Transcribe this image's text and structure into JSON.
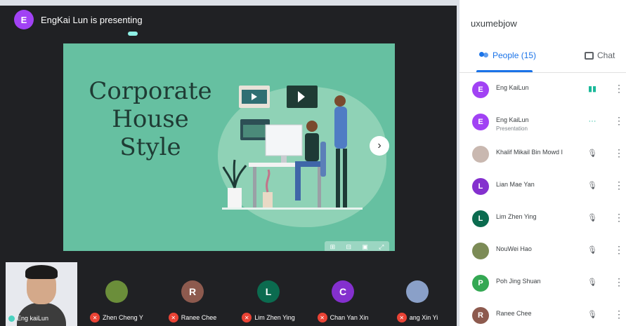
{
  "presenter": {
    "initial": "E",
    "text": "EngKai Lun is presenting",
    "color": "#a142f4"
  },
  "slide": {
    "title_lines": [
      "Corporate",
      "House",
      "Style"
    ],
    "next_icon": "chevron-right-icon",
    "controls": [
      "⊞",
      "⊟",
      "▣",
      "⤢"
    ]
  },
  "self_view": {
    "name": "Eng kaiLun"
  },
  "filmstrip": [
    {
      "name": "Zhen Cheng Y",
      "initial": "",
      "color": "#6b8e3a"
    },
    {
      "name": "Ranee Chee",
      "initial": "R",
      "color": "#8d5a4e"
    },
    {
      "name": "Lim Zhen Ying",
      "initial": "L",
      "color": "#0b6b4f"
    },
    {
      "name": "Chan Yan Xin",
      "initial": "C",
      "color": "#8430ce"
    },
    {
      "name": "ang Xin Yi",
      "initial": "",
      "color": "#8aa0c8"
    }
  ],
  "panel": {
    "title": "uxumebjow",
    "tab_people": "People (15)",
    "tab_chat": "Chat",
    "people": [
      {
        "name": "Eng KaiLun",
        "sub": "",
        "initial": "E",
        "color": "#a142f4",
        "mic": "speaking"
      },
      {
        "name": "Eng KaiLun",
        "sub": "Presentation",
        "initial": "E",
        "color": "#a142f4",
        "mic": "presenting"
      },
      {
        "name": "Khalif Mikail Bin Mowd I",
        "sub": "",
        "initial": "",
        "color": "#c9b8b0",
        "mic": "muted"
      },
      {
        "name": "Lian Mae Yan",
        "sub": "",
        "initial": "L",
        "color": "#8430ce",
        "mic": "muted"
      },
      {
        "name": "Lim Zhen Ying",
        "sub": "",
        "initial": "L",
        "color": "#0b6b4f",
        "mic": "muted"
      },
      {
        "name": "NouWei Hao",
        "sub": "",
        "initial": "",
        "color": "#7c8b56",
        "mic": "muted"
      },
      {
        "name": "Poh Jing Shuan",
        "sub": "",
        "initial": "P",
        "color": "#34a853",
        "mic": "muted"
      },
      {
        "name": "Ranee Chee",
        "sub": "",
        "initial": "R",
        "color": "#8d5a4e",
        "mic": "muted"
      }
    ]
  }
}
